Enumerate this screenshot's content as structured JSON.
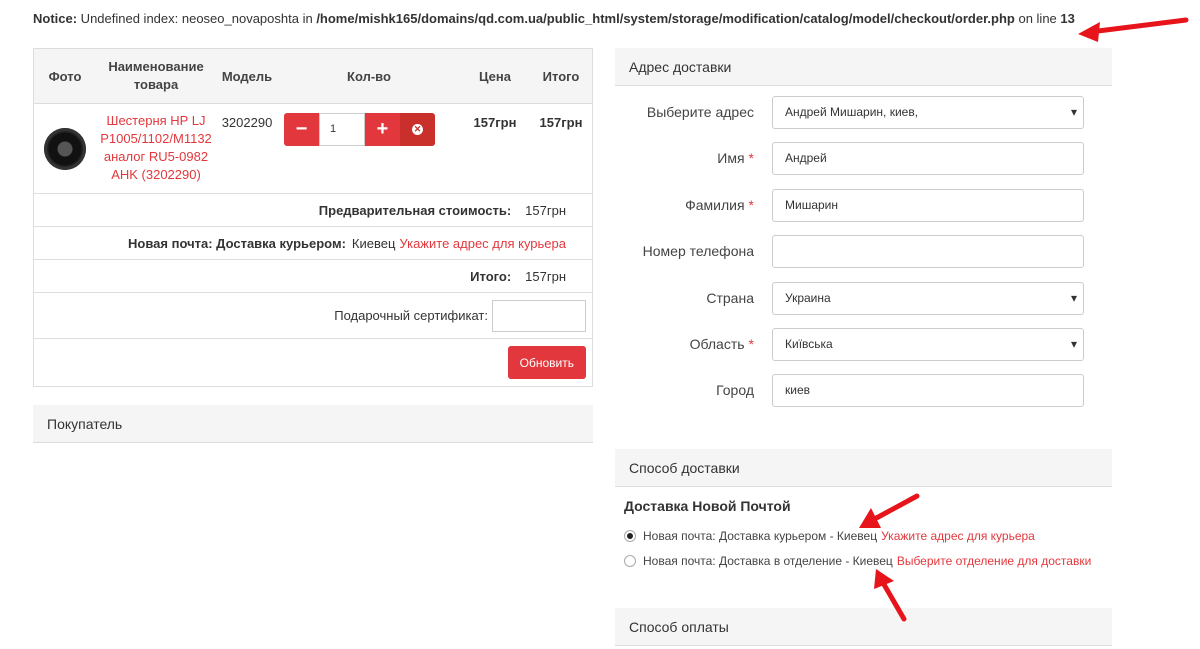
{
  "notice": {
    "label": "Notice:",
    "text": " Undefined index: neoseo_novaposhta in ",
    "path": "/home/mishk165/domains/qd.com.ua/public_html/system/storage/modification/catalog/model/checkout/order.php",
    "on": " on line ",
    "line": "13"
  },
  "cart": {
    "headers": {
      "photo": "Фото",
      "name": "Наименование товара",
      "model": "Модель",
      "qty": "Кол-во",
      "price": "Цена",
      "total": "Итого"
    },
    "item": {
      "name": "Шестерня HP LJ P1005/1102/M1132 аналог RU5-0982 AHK (3202290)",
      "model": "3202290",
      "qty": "1",
      "price": "157грн",
      "total": "157грн"
    },
    "subtotal_label": "Предварительная стоимость:",
    "subtotal_value": "157грн",
    "shipping_label": "Новая почта: Доставка курьером:",
    "shipping_city": "Киевец",
    "shipping_link": "Укажите адрес для курьера",
    "total_label": "Итого:",
    "total_value": "157грн",
    "certificate_label": "Подарочный сертификат:",
    "update_button": "Обновить"
  },
  "buyer_panel": "Покупатель",
  "address": {
    "panel_title": "Адрес доставки",
    "fields": [
      {
        "label": "Выберите адрес",
        "value": "Андрей Мишарин, киев,",
        "required": false,
        "select": true
      },
      {
        "label": "Имя",
        "value": "Андрей",
        "required": true,
        "select": false
      },
      {
        "label": "Фамилия",
        "value": "Мишарин",
        "required": true,
        "select": false
      },
      {
        "label": "Номер телефона",
        "value": "",
        "required": false,
        "select": false
      },
      {
        "label": "Страна",
        "value": "Украина",
        "required": false,
        "select": true
      },
      {
        "label": "Область",
        "value": "Київська",
        "required": true,
        "select": true
      },
      {
        "label": "Город",
        "value": "киев",
        "required": false,
        "select": false
      }
    ],
    "required_mark": "*"
  },
  "delivery": {
    "panel_title": "Способ доставки",
    "group_title": "Доставка Новой Почтой",
    "options": [
      {
        "text": "Новая почта: Доставка курьером - Киевец",
        "link": "Укажите адрес для курьера",
        "selected": true
      },
      {
        "text": "Новая почта: Доставка в отделение - Киевец",
        "link": "Выберите отделение для доставки",
        "selected": false
      }
    ]
  },
  "payment": {
    "panel_title": "Способ оплаты"
  },
  "colors": {
    "accent": "#e2383d",
    "arrow": "#e8141b"
  }
}
